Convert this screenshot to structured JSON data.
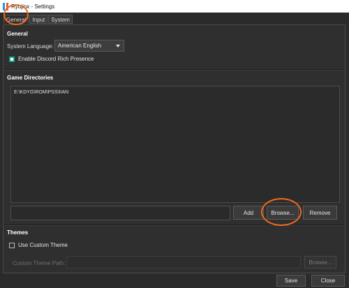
{
  "window": {
    "title": "Ryujinx - Settings"
  },
  "tabs": [
    {
      "label": "General"
    },
    {
      "label": "Input"
    },
    {
      "label": "System"
    }
  ],
  "general": {
    "heading": "General",
    "language_label": "System Language:",
    "language_value": "American English",
    "discord_label": "Enable Discord Rich Presence",
    "discord_checked": true
  },
  "game_dirs": {
    "heading": "Game Directories",
    "items": [
      "E:\\KDYG\\ROM\\PSS\\IIAN"
    ],
    "add_label": "Add",
    "browse_label": "Browse...",
    "remove_label": "Remove"
  },
  "themes": {
    "heading": "Themes",
    "custom_theme_label": "Use Custom Theme",
    "custom_theme_checked": false,
    "theme_path_label": "Custom Theme Path:",
    "theme_browse_label": "Browse..."
  },
  "footer": {
    "save_label": "Save",
    "close_label": "Close"
  },
  "annotations": {
    "color": "#f06a1e"
  }
}
